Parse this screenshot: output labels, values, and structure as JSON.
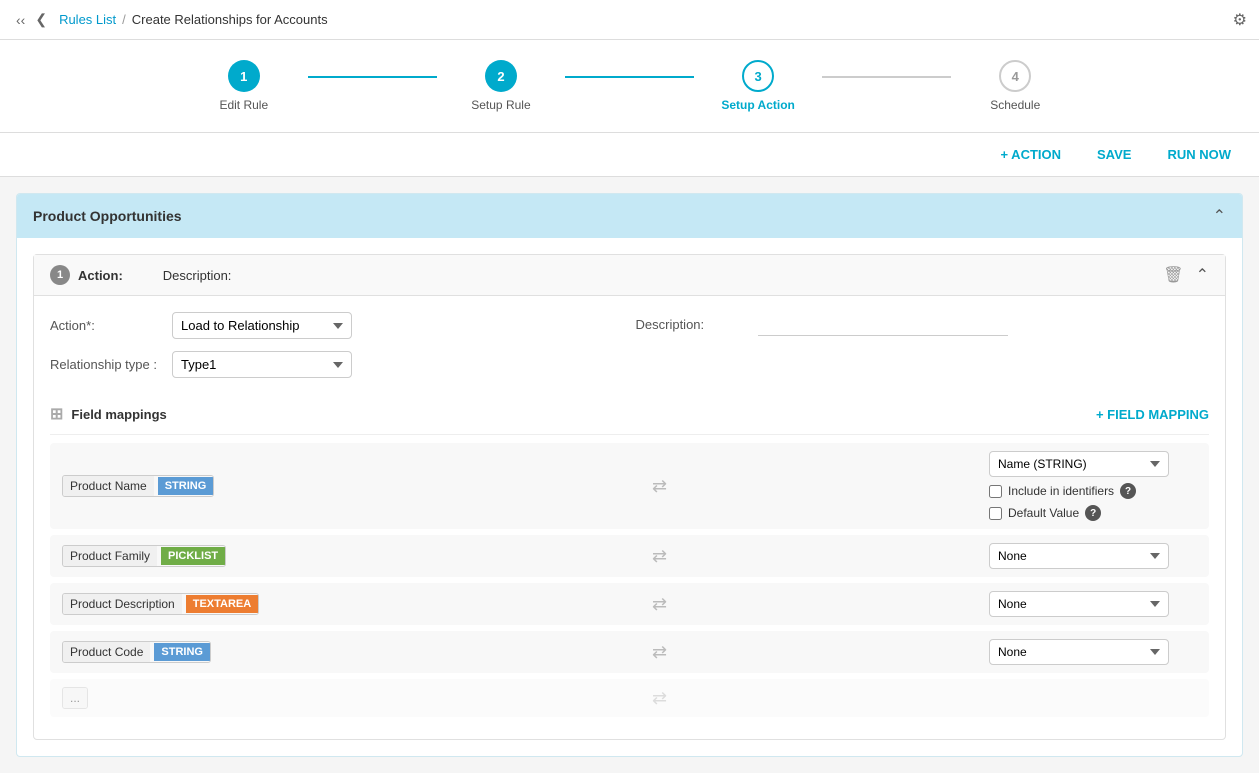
{
  "nav": {
    "breadcrumb_link": "Rules List",
    "breadcrumb_sep": "/",
    "breadcrumb_current": "Create Relationships for Accounts"
  },
  "stepper": {
    "steps": [
      {
        "number": "1",
        "label": "Edit Rule",
        "state": "completed"
      },
      {
        "number": "2",
        "label": "Setup Rule",
        "state": "completed"
      },
      {
        "number": "3",
        "label": "Setup Action",
        "state": "active"
      },
      {
        "number": "4",
        "label": "Schedule",
        "state": "inactive"
      }
    ]
  },
  "toolbar": {
    "action_label": "+ ACTION",
    "save_label": "SAVE",
    "run_now_label": "RUN NOW"
  },
  "section": {
    "title": "Product Opportunities"
  },
  "action": {
    "number": "1",
    "label": "Action:",
    "description_label": "Description:",
    "action_field_label": "Action*:",
    "action_value": "Load to Relationship",
    "relationship_type_label": "Relationship type :",
    "relationship_type_value": "Type1",
    "description_value": ""
  },
  "field_mappings": {
    "title": "Field mappings",
    "add_button": "+ FIELD MAPPING",
    "rows": [
      {
        "tag_name": "Product Name",
        "tag_type": "STRING",
        "tag_class": "string",
        "select_value": "Name (STRING)",
        "show_identifiers": true,
        "show_default": true,
        "include_label": "Include in identifiers",
        "default_label": "Default Value"
      },
      {
        "tag_name": "Product Family",
        "tag_type": "PICKLIST",
        "tag_class": "picklist",
        "select_value": "None",
        "show_identifiers": false,
        "show_default": false
      },
      {
        "tag_name": "Product Description",
        "tag_type": "TEXTAREA",
        "tag_class": "textarea",
        "select_value": "None",
        "show_identifiers": false,
        "show_default": false
      },
      {
        "tag_name": "Product Code",
        "tag_type": "STRING",
        "tag_class": "string",
        "select_value": "None",
        "show_identifiers": false,
        "show_default": false
      }
    ]
  },
  "colors": {
    "accent": "#00aacc",
    "header_bg": "#c5e8f5"
  }
}
